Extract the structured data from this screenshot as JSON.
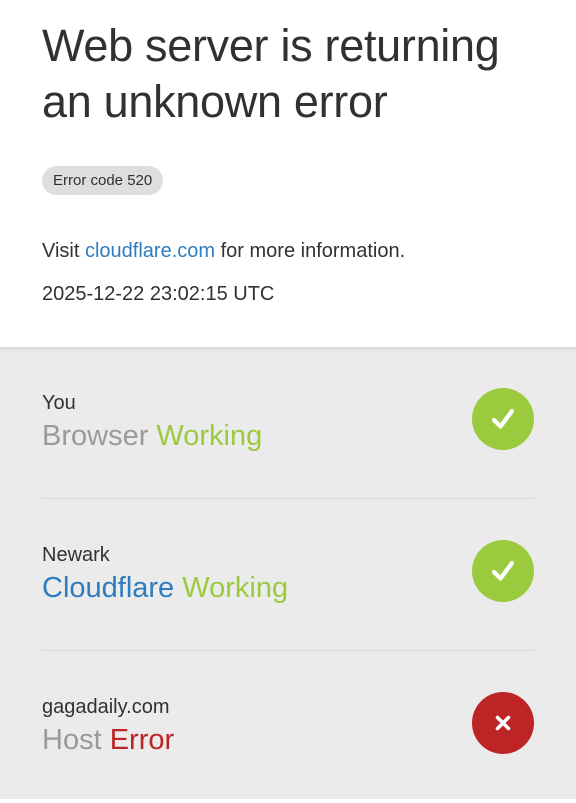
{
  "header": {
    "title": "Web server is returning an unknown error",
    "error_code": "Error code 520",
    "visit_prefix": "Visit",
    "visit_link": "cloudflare.com",
    "visit_suffix": "for more information.",
    "timestamp": "2025-12-22 23:02:15 UTC"
  },
  "colors": {
    "working": "#9bca3e",
    "error": "#bd2426",
    "link": "#2f7bbf",
    "panel_bg": "#ebebeb"
  },
  "diagnostics": [
    {
      "location": "You",
      "name": "Browser",
      "status": "Working",
      "icon": "check-icon"
    },
    {
      "location": "Newark",
      "name": "Cloudflare",
      "status": "Working",
      "icon": "check-icon"
    },
    {
      "location": "gagadaily.com",
      "name": "Host",
      "status": "Error",
      "icon": "x-icon"
    }
  ]
}
